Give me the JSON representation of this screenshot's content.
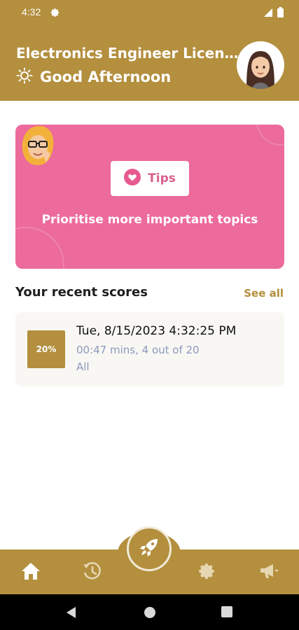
{
  "status_bar": {
    "time": "4:32"
  },
  "header": {
    "title": "Electronics Engineer Licen...",
    "greeting": "Good Afternoon"
  },
  "tips_card": {
    "button_label": "Tips",
    "message": "Prioritise more important topics"
  },
  "recent_scores": {
    "title": "Your recent scores",
    "see_all_label": "See all",
    "items": [
      {
        "percent": "20%",
        "date": "Tue, 8/15/2023 4:32:25 PM",
        "meta": "00:47 mins, 4 out of 20",
        "category": "All"
      }
    ]
  },
  "bottom_nav": {
    "items": [
      "home-icon",
      "history-icon",
      "rocket-icon",
      "gear-icon",
      "megaphone-icon"
    ]
  },
  "colors": {
    "brand": "#b38f3e",
    "tips_pink": "#ec6a9c",
    "meta_text": "#8d99bd"
  }
}
